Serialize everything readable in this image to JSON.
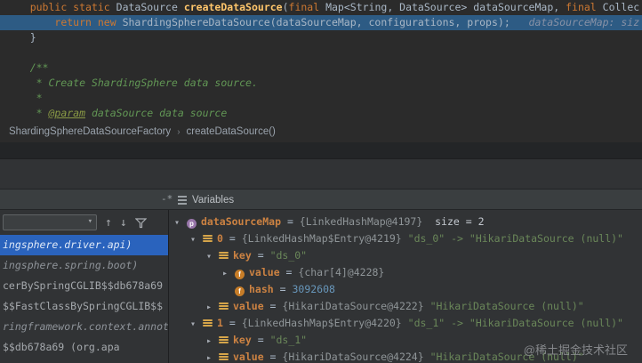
{
  "editor": {
    "lines": [
      {
        "exec": false,
        "tokens": [
          {
            "t": "    ",
            "c": "plain"
          },
          {
            "t": "public static ",
            "c": "kw"
          },
          {
            "t": "DataSource ",
            "c": "plain"
          },
          {
            "t": "createDataSource",
            "c": "method"
          },
          {
            "t": "(",
            "c": "plain"
          },
          {
            "t": "final ",
            "c": "kw"
          },
          {
            "t": "Map<String, DataSource> dataSourceMap, ",
            "c": "plain"
          },
          {
            "t": "final ",
            "c": "kw"
          },
          {
            "t": "Collec",
            "c": "plain"
          }
        ]
      },
      {
        "exec": true,
        "tokens": [
          {
            "t": "        ",
            "c": "plain"
          },
          {
            "t": "return new ",
            "c": "kw"
          },
          {
            "t": "ShardingSphereDataSource(dataSourceMap, configurations, props);",
            "c": "plain"
          },
          {
            "t": "   ",
            "c": "plain"
          },
          {
            "t": "dataSourceMap: siz",
            "c": "hint"
          }
        ]
      },
      {
        "exec": false,
        "tokens": [
          {
            "t": "    }",
            "c": "plain"
          }
        ]
      },
      {
        "exec": false,
        "tokens": []
      },
      {
        "exec": false,
        "tokens": [
          {
            "t": "    /**",
            "c": "comment"
          }
        ]
      },
      {
        "exec": false,
        "tokens": [
          {
            "t": "     * Create ShardingSphere data source.",
            "c": "comment"
          }
        ]
      },
      {
        "exec": false,
        "tokens": [
          {
            "t": "     *",
            "c": "comment"
          }
        ]
      },
      {
        "exec": false,
        "tokens": [
          {
            "t": "     * ",
            "c": "comment"
          },
          {
            "t": "@param",
            "c": "doctag"
          },
          {
            "t": " dataSource data source",
            "c": "comment"
          }
        ]
      }
    ]
  },
  "breadcrumb": {
    "items": [
      "ShardingSphereDataSourceFactory",
      "createDataSource()"
    ],
    "separator": "›"
  },
  "debugger": {
    "tab_label": "Variables",
    "glyphs": {
      "collapse": "-*",
      "chevron_down": "▾",
      "chevron_right": "▸",
      "arrow_up": "↑",
      "arrow_down": "↓"
    },
    "frames": {
      "items": [
        {
          "text": "ingsphere.driver.api)",
          "style": "sel"
        },
        {
          "text": "ingsphere.spring.boot)",
          "style": "pkg"
        },
        {
          "text": "cerBySpringCGLIB$$db678a69",
          "style": "cls"
        },
        {
          "text": "$$FastClassBySpringCGLIB$$",
          "style": "cls"
        },
        {
          "text": "ringframework.context.annot",
          "style": "pkg"
        },
        {
          "text": "$$db678a69 (org.apa",
          "style": "cls"
        }
      ]
    },
    "variables": {
      "rows": [
        {
          "indent": 0,
          "chevron": "down",
          "icon": "param",
          "tokens": [
            {
              "t": "dataSourceMap",
              "c": "name"
            },
            {
              "t": " = ",
              "c": "eq"
            },
            {
              "t": "{LinkedHashMap@4197}",
              "c": "ref"
            },
            {
              "t": "  size = 2",
              "c": "plainval"
            }
          ]
        },
        {
          "indent": 1,
          "chevron": "down",
          "icon": "item",
          "tokens": [
            {
              "t": "0",
              "c": "name"
            },
            {
              "t": " = ",
              "c": "eq"
            },
            {
              "t": "{LinkedHashMap$Entry@4219}",
              "c": "ref"
            },
            {
              "t": " \"ds_0\" -> \"HikariDataSource (null)\"",
              "c": "str"
            }
          ]
        },
        {
          "indent": 2,
          "chevron": "down",
          "icon": "item",
          "tokens": [
            {
              "t": "key",
              "c": "name"
            },
            {
              "t": " = ",
              "c": "eq"
            },
            {
              "t": "\"ds_0\"",
              "c": "str"
            }
          ]
        },
        {
          "indent": 3,
          "chevron": "right",
          "icon": "field",
          "tokens": [
            {
              "t": "value",
              "c": "name"
            },
            {
              "t": " = ",
              "c": "eq"
            },
            {
              "t": "{char[4]@4228}",
              "c": "ref"
            }
          ]
        },
        {
          "indent": 3,
          "chevron": "none",
          "icon": "field",
          "tokens": [
            {
              "t": "hash",
              "c": "name"
            },
            {
              "t": " = ",
              "c": "eq"
            },
            {
              "t": "3092608",
              "c": "num"
            }
          ]
        },
        {
          "indent": 2,
          "chevron": "right",
          "icon": "item",
          "tokens": [
            {
              "t": "value",
              "c": "name"
            },
            {
              "t": " = ",
              "c": "eq"
            },
            {
              "t": "{HikariDataSource@4222}",
              "c": "ref"
            },
            {
              "t": " \"HikariDataSource (null)\"",
              "c": "str"
            }
          ]
        },
        {
          "indent": 1,
          "chevron": "down",
          "icon": "item",
          "tokens": [
            {
              "t": "1",
              "c": "name"
            },
            {
              "t": " = ",
              "c": "eq"
            },
            {
              "t": "{LinkedHashMap$Entry@4220}",
              "c": "ref"
            },
            {
              "t": " \"ds_1\" -> \"HikariDataSource (null)\"",
              "c": "str"
            }
          ]
        },
        {
          "indent": 2,
          "chevron": "right",
          "icon": "item",
          "tokens": [
            {
              "t": "key",
              "c": "name"
            },
            {
              "t": " = ",
              "c": "eq"
            },
            {
              "t": "\"ds_1\"",
              "c": "str"
            }
          ]
        },
        {
          "indent": 2,
          "chevron": "right",
          "icon": "item",
          "tokens": [
            {
              "t": "value",
              "c": "name"
            },
            {
              "t": " = ",
              "c": "eq"
            },
            {
              "t": "{HikariDataSource@4224}",
              "c": "ref"
            },
            {
              "t": " \"HikariDataSource (null)\"",
              "c": "str"
            }
          ]
        }
      ]
    }
  },
  "watermark": "@稀土掘金技术社区",
  "colors": {
    "editor_bg": "#2b2b2b",
    "panel_bg": "#313335",
    "exec_line_bg": "#2d5b84",
    "frame_selection": "#2a63bd",
    "keyword": "#cc7832",
    "string_green": "#6a8759",
    "name_orange": "#cc8242",
    "comment_green": "#629755"
  }
}
